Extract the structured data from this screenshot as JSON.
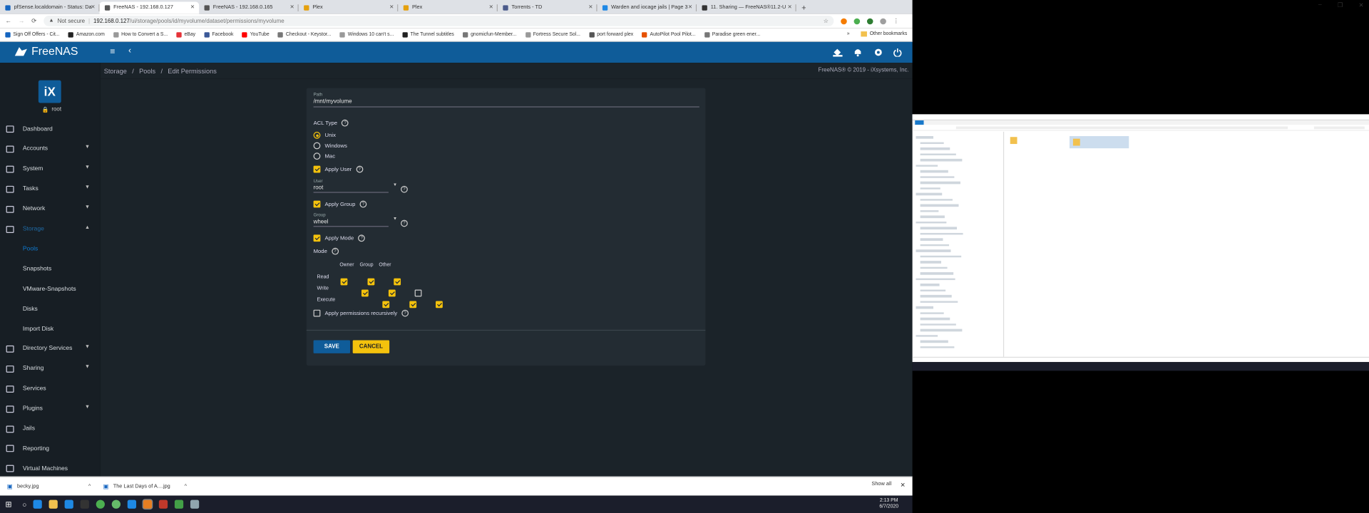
{
  "browser": {
    "tabs": [
      {
        "label": "pfSense.localdomain - Status: Da",
        "color": "#1565c0"
      },
      {
        "label": "FreeNAS - 192.168.0.127",
        "color": "#555555",
        "active": true
      },
      {
        "label": "FreeNAS - 192.168.0.165",
        "color": "#555555"
      },
      {
        "label": "Plex",
        "color": "#e5a00d"
      },
      {
        "label": "Plex",
        "color": "#e5a00d"
      },
      {
        "label": "Torrents - TD",
        "color": "#4a5a8a"
      },
      {
        "label": "Warden and iocage jails | Page 3",
        "color": "#1e88e5"
      },
      {
        "label": "11. Sharing — FreeNAS®11.2-U",
        "color": "#333333"
      }
    ],
    "new_tab": "+",
    "window_controls": [
      "–",
      "❐",
      "✕"
    ],
    "nav": {
      "back": "←",
      "forward": "→",
      "reload": "⟳"
    },
    "address": {
      "not_secure": "Not secure",
      "host": "192.168.0.127",
      "path": "/ui/storage/pools/id/myvolume/dataset/permissions/myvolume"
    },
    "star": "☆",
    "menu": "⋮",
    "bookmarks": [
      {
        "label": "Sign Off Offers - Cit...",
        "color": "#1565c0"
      },
      {
        "label": "Amazon.com",
        "color": "#222222"
      },
      {
        "label": "How to Convert a S...",
        "color": "#999999"
      },
      {
        "label": "eBay",
        "color": "#e53238"
      },
      {
        "label": "Facebook",
        "color": "#3b5998"
      },
      {
        "label": "YouTube",
        "color": "#ff0000"
      },
      {
        "label": "Checkout - Keystor...",
        "color": "#777777"
      },
      {
        "label": "Windows 10 can't s...",
        "color": "#999999"
      },
      {
        "label": "The Tunnel subtitles",
        "color": "#222222"
      },
      {
        "label": "gnomicfun-Member...",
        "color": "#777777"
      },
      {
        "label": "Fortress Secure Sol...",
        "color": "#999999"
      },
      {
        "label": "port forward plex",
        "color": "#555555"
      },
      {
        "label": "AutoPilot Pool Pilot...",
        "color": "#e65100"
      },
      {
        "label": "Paradise green ener...",
        "color": "#777777"
      }
    ],
    "bookmarks_more": "»",
    "other_bookmarks": "Other bookmarks"
  },
  "freenas": {
    "brand": "FreeNAS",
    "copyright": "FreeNAS® © 2019 - iXsystems, Inc.",
    "breadcrumb": [
      "Storage",
      "/",
      "Pools",
      "/",
      "Edit Permissions"
    ],
    "user": {
      "avatar": "iX",
      "name": "root"
    },
    "sidebar": [
      {
        "label": "Dashboard",
        "icon": "dashboard-icon"
      },
      {
        "label": "Accounts",
        "icon": "accounts-icon",
        "caret": "▼"
      },
      {
        "label": "System",
        "icon": "system-icon",
        "caret": "▼"
      },
      {
        "label": "Tasks",
        "icon": "tasks-icon",
        "caret": "▼"
      },
      {
        "label": "Network",
        "icon": "network-icon",
        "caret": "▼"
      },
      {
        "label": "Storage",
        "icon": "storage-icon",
        "caret": "▲",
        "active": true
      },
      {
        "label": "Pools",
        "sub": true,
        "active": true
      },
      {
        "label": "Snapshots",
        "sub": true
      },
      {
        "label": "VMware-Snapshots",
        "sub": true
      },
      {
        "label": "Disks",
        "sub": true
      },
      {
        "label": "Import Disk",
        "sub": true
      },
      {
        "label": "Directory Services",
        "icon": "directory-icon",
        "caret": "▼"
      },
      {
        "label": "Sharing",
        "icon": "sharing-icon",
        "caret": "▼"
      },
      {
        "label": "Services",
        "icon": "services-icon"
      },
      {
        "label": "Plugins",
        "icon": "plugins-icon",
        "caret": "▼"
      },
      {
        "label": "Jails",
        "icon": "jails-icon"
      },
      {
        "label": "Reporting",
        "icon": "reporting-icon"
      },
      {
        "label": "Virtual Machines",
        "icon": "vm-icon"
      }
    ],
    "form": {
      "path_label": "Path",
      "path_value": "/mnt/myvolume",
      "acl_label": "ACL Type",
      "acl_options": [
        "Unix",
        "Windows",
        "Mac"
      ],
      "acl_selected": "Unix",
      "apply_user": "Apply User",
      "user_label": "User",
      "user_value": "root",
      "apply_group": "Apply Group",
      "group_label": "Group",
      "group_value": "wheel",
      "apply_mode": "Apply Mode",
      "mode_label": "Mode",
      "mode_cols": [
        "Owner",
        "Group",
        "Other"
      ],
      "mode_rows": [
        {
          "label": "Read",
          "values": [
            true,
            true,
            true
          ]
        },
        {
          "label": "Write",
          "values": [
            true,
            true,
            false
          ]
        },
        {
          "label": "Execute",
          "values": [
            true,
            true,
            true
          ]
        }
      ],
      "recursive": "Apply permissions recursively",
      "save": "SAVE",
      "cancel": "CANCEL",
      "help": "?",
      "select_caret": "▼"
    },
    "colors": {
      "topbar": "#0f5c99",
      "accent": "#f4c20d",
      "save_bg": "#0f5c99"
    }
  },
  "downloads": {
    "items": [
      {
        "name": "becky.jpg"
      },
      {
        "name": "The Last Days of A....jpg"
      }
    ],
    "show_all": "Show all",
    "caret": "^",
    "close": "✕"
  },
  "taskbar": {
    "time": "2:13 PM",
    "date": "6/7/2020"
  }
}
